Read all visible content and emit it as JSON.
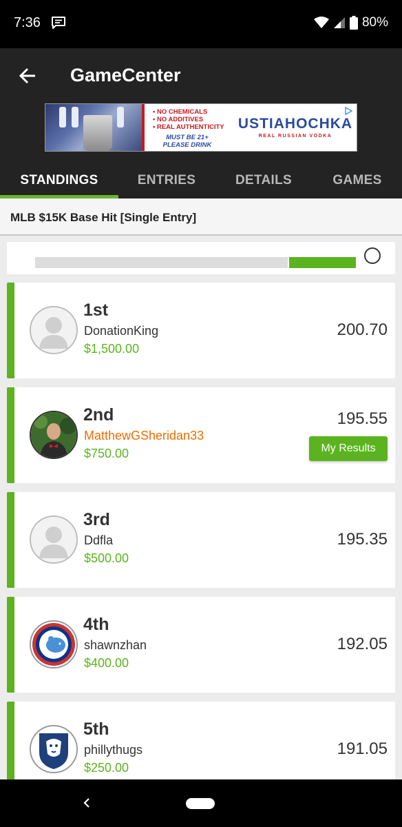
{
  "status_bar": {
    "time": "7:36",
    "battery": "80%"
  },
  "app_bar": {
    "title": "GameCenter"
  },
  "ad": {
    "lines": [
      "• NO CHEMICALS",
      "• NO ADDITIVES",
      "• REAL AUTHENTICITY"
    ],
    "must": "MUST BE 21+",
    "please": "PLEASE DRINK",
    "brand": "USTIAHOCHKA",
    "tagline": "REAL RUSSIAN VODKA"
  },
  "tabs": [
    {
      "label": "STANDINGS",
      "active": true
    },
    {
      "label": "ENTRIES",
      "active": false
    },
    {
      "label": "DETAILS",
      "active": false
    },
    {
      "label": "GAMES",
      "active": false
    }
  ],
  "contest": {
    "title": "MLB $15K Base Hit [Single Entry]"
  },
  "progress": {
    "gray_fraction": 0.72,
    "green_fraction": 0.19,
    "knob_fraction": 0.96
  },
  "standings": [
    {
      "rank": "1st",
      "username": "DonationKing",
      "prize": "$1,500.00",
      "score": "200.70",
      "avatar": "default"
    },
    {
      "rank": "2nd",
      "username": "MatthewGSheridan33",
      "prize": "$750.00",
      "score": "195.55",
      "avatar": "photo",
      "my_results": "My Results"
    },
    {
      "rank": "3rd",
      "username": "Ddfla",
      "prize": "$500.00",
      "score": "195.35",
      "avatar": "default"
    },
    {
      "rank": "4th",
      "username": "shawnzhan",
      "prize": "$400.00",
      "score": "192.05",
      "avatar": "cubs-logo"
    },
    {
      "rank": "5th",
      "username": "phillythugs",
      "prize": "$250.00",
      "score": "191.05",
      "avatar": "penn-state-logo"
    }
  ],
  "colors": {
    "accent_green": "#5cb320",
    "highlight_orange": "#ef6c00",
    "app_bar": "#232323"
  }
}
